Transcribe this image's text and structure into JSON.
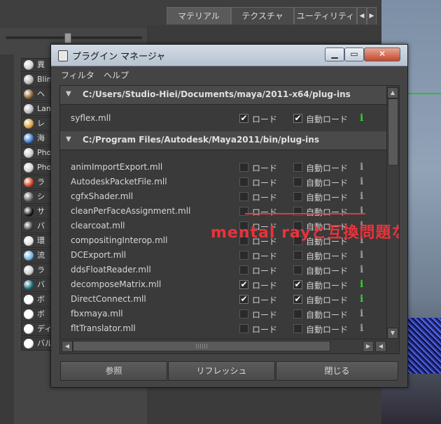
{
  "background": {
    "tabs": [
      "マテリアル",
      "テクスチャ",
      "ユーティリティ"
    ],
    "shader_items": [
      {
        "label": "異",
        "color": "#cfcfcf"
      },
      {
        "label": "Blin",
        "color": "#b0b0b0"
      },
      {
        "label": "ヘ",
        "color": "#8a5a2a"
      },
      {
        "label": "Lam",
        "color": "#b8b8b8"
      },
      {
        "label": "レ",
        "color": "#d6a040"
      },
      {
        "label": "海",
        "color": "#3a7ad0"
      },
      {
        "label": "Pho",
        "color": "#c8c8c8"
      },
      {
        "label": "Pho",
        "color": "#d0d0d0"
      },
      {
        "label": "ラ",
        "color": "#d04020"
      },
      {
        "label": "シ",
        "color": "#606060"
      },
      {
        "label": "サ",
        "color": "#111111"
      },
      {
        "label": "バ",
        "color": "#3a3a3a"
      },
      {
        "label": "環",
        "color": "#e0e0e0"
      },
      {
        "label": "流",
        "color": "#6fb0e0"
      },
      {
        "label": "ラ",
        "color": "#cccccc"
      },
      {
        "label": "バ",
        "color": "#1a6a7a"
      },
      {
        "label": "ボ",
        "color": "#ffffff"
      },
      {
        "label": "ボ",
        "color": "#ffffff"
      },
      {
        "label": "ディスプレイスメント",
        "color": "#ffffff"
      },
      {
        "label": "バルジ",
        "color": "#ffffff"
      }
    ]
  },
  "dialog": {
    "title": "プラグイン マネージャ",
    "window_buttons": {
      "minimize": "▁",
      "maximize": "▭",
      "close": "✕"
    },
    "menu": [
      "フィルタ",
      "ヘルプ"
    ],
    "sections": [
      {
        "path": "C:/Users/Studio-Hiei/Documents/maya/2011-x64/plug-ins",
        "plugins": [
          {
            "name": "syflex.mll",
            "load": true,
            "autoload": true,
            "info_active": true
          }
        ]
      },
      {
        "path": "C:/Program Files/Autodesk/Maya2011/bin/plug-ins",
        "plugins": [
          {
            "name": "animImportExport.mll",
            "load": false,
            "autoload": false,
            "info_active": false
          },
          {
            "name": "AutodeskPacketFile.mll",
            "load": false,
            "autoload": false,
            "info_active": false
          },
          {
            "name": "cgfxShader.mll",
            "load": false,
            "autoload": false,
            "info_active": false
          },
          {
            "name": "cleanPerFaceAssignment.mll",
            "load": false,
            "autoload": false,
            "info_active": false
          },
          {
            "name": "clearcoat.mll",
            "load": false,
            "autoload": false,
            "info_active": false
          },
          {
            "name": "compositingInterop.mll",
            "load": false,
            "autoload": false,
            "info_active": false
          },
          {
            "name": "DCExport.mll",
            "load": false,
            "autoload": false,
            "info_active": false
          },
          {
            "name": "ddsFloatReader.mll",
            "load": false,
            "autoload": false,
            "info_active": false
          },
          {
            "name": "decomposeMatrix.mll",
            "load": true,
            "autoload": true,
            "info_active": true
          },
          {
            "name": "DirectConnect.mll",
            "load": true,
            "autoload": true,
            "info_active": true
          },
          {
            "name": "fbxmaya.mll",
            "load": false,
            "autoload": false,
            "info_active": false
          },
          {
            "name": "fltTranslator.mll",
            "load": false,
            "autoload": false,
            "info_active": false
          }
        ]
      }
    ],
    "load_label": "ロード",
    "autoload_label": "自動ロード",
    "info_glyph": "i",
    "annotation": "mental rayと互換問題なし",
    "buttons": {
      "browse": "参照",
      "refresh": "リフレッシュ",
      "close": "閉じる"
    }
  },
  "colors": {
    "info_active": "#37d12e",
    "annotation": "#e8333a"
  }
}
